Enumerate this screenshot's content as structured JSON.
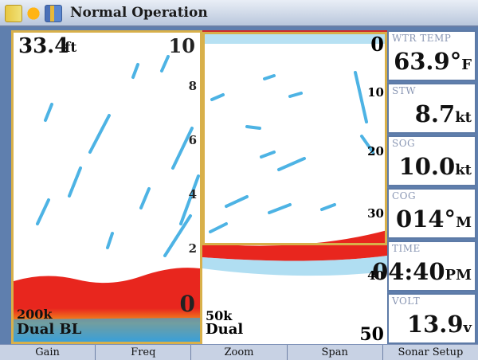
{
  "titlebar": {
    "title": "Normal Operation",
    "icons": [
      "signal-icon",
      "sun-icon",
      "battery-icon"
    ]
  },
  "left_sonar": {
    "depth": "33.4",
    "depth_unit": "ft",
    "scale_top": "10",
    "scale_marks": [
      "8",
      "6",
      "4",
      "2"
    ],
    "scale_bottom": "0",
    "frequency": "200k",
    "mode": "Dual BL"
  },
  "mid_sonar": {
    "scale_top": "0",
    "scale_marks": [
      "10",
      "20",
      "30",
      "40"
    ],
    "scale_bottom": "50",
    "frequency": "50k",
    "mode": "Dual"
  },
  "fields": [
    {
      "label": "WTR TEMP",
      "value": "63.9°",
      "unit": "F"
    },
    {
      "label": "STW",
      "value": "8.7",
      "unit": "kt"
    },
    {
      "label": "SOG",
      "value": "10.0",
      "unit": "kt"
    },
    {
      "label": "COG",
      "value": "014°",
      "unit": "M"
    },
    {
      "label": "TIME",
      "value": "04:40",
      "unit": "PM"
    },
    {
      "label": "VOLT",
      "value": "13.9",
      "unit": "v"
    }
  ],
  "softkeys": [
    "Gain",
    "Freq",
    "Zoom",
    "Span",
    "Sonar Setup"
  ],
  "colors": {
    "frame": "#5f7fae",
    "highlight": "#d8b04a",
    "bottom_return": "#e8261e",
    "fish_return": "#2fa6e0"
  }
}
